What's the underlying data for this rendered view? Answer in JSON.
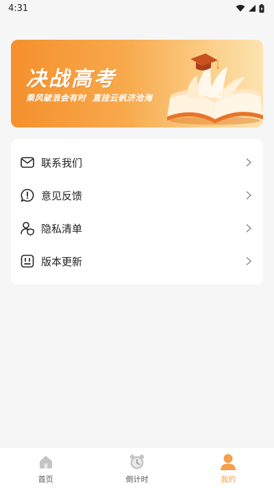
{
  "status_bar": {
    "time": "4:31"
  },
  "banner": {
    "title": "决战高考",
    "subtitle": "乘风破浪会有时  直挂云帆济沧海",
    "icon": "book-graduation-cap-illustration"
  },
  "menu": {
    "items": [
      {
        "label": "联系我们",
        "icon": "mail-icon"
      },
      {
        "label": "意见反馈",
        "icon": "feedback-icon"
      },
      {
        "label": "隐私清单",
        "icon": "user-shield-icon"
      },
      {
        "label": "版本更新",
        "icon": "update-icon"
      }
    ]
  },
  "tab_bar": {
    "active": "我的",
    "tabs": [
      {
        "label": "首页",
        "icon": "home-icon"
      },
      {
        "label": "倒计时",
        "icon": "alarm-clock-icon"
      },
      {
        "label": "我的",
        "icon": "profile-icon"
      }
    ]
  },
  "colors": {
    "accent": "#f5a04a",
    "banner_start": "#f5902c",
    "banner_end": "#fde3b0",
    "inactive_icon": "#c4c4c4"
  }
}
